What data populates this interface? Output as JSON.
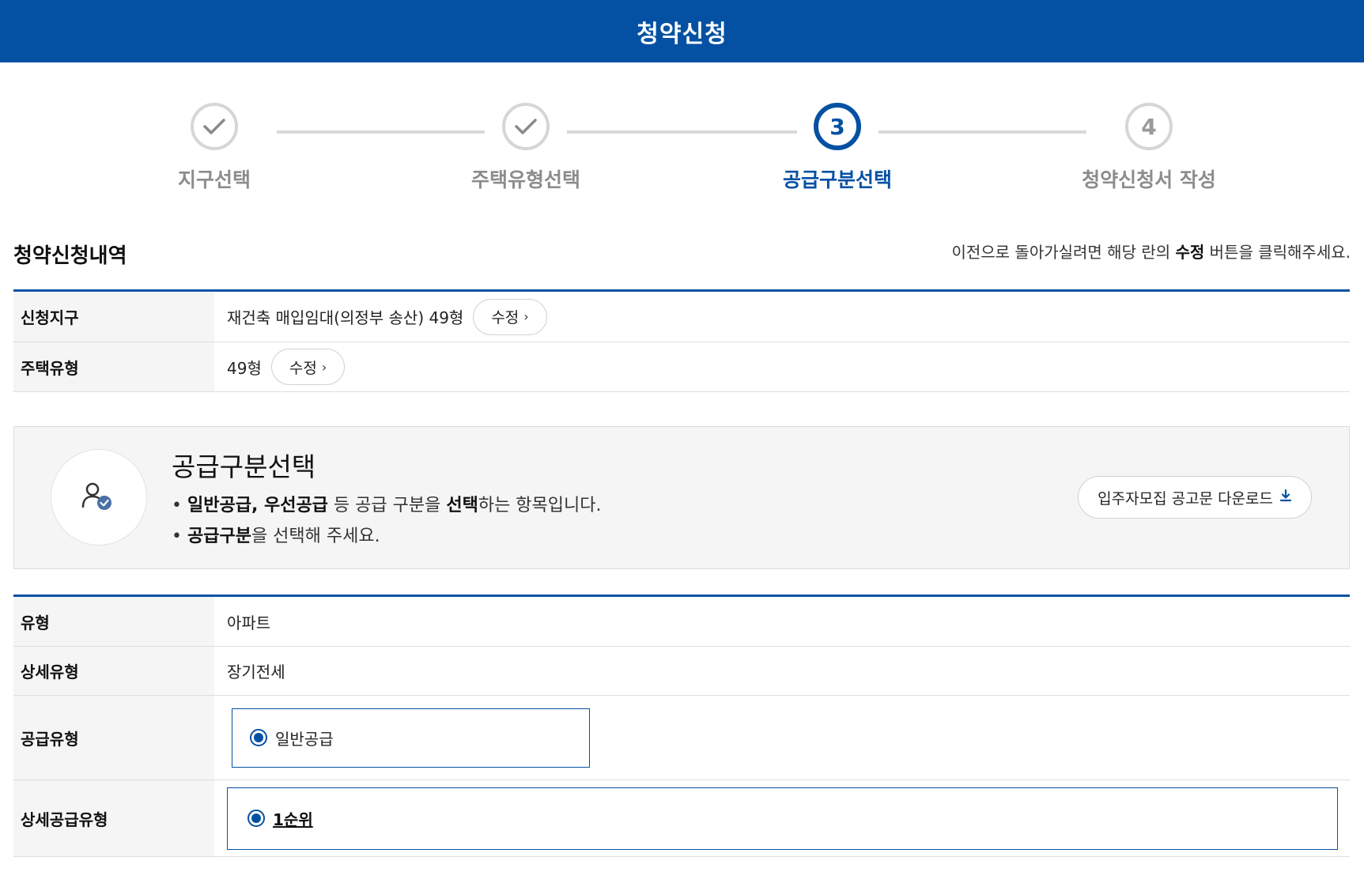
{
  "header": {
    "title": "청약신청"
  },
  "stepper": {
    "steps": [
      {
        "label": "지구선택",
        "state": "done",
        "icon": "check-icon"
      },
      {
        "label": "주택유형선택",
        "state": "done",
        "icon": "check-icon"
      },
      {
        "label": "공급구분선택",
        "state": "active",
        "number": "3"
      },
      {
        "label": "청약신청서 작성",
        "state": "pending",
        "number": "4"
      }
    ]
  },
  "summary": {
    "title": "청약신청내역",
    "hint_prefix": "이전으로 돌아가실려면 해당 란의 ",
    "hint_bold": "수정",
    "hint_suffix": " 버튼을 클릭해주세요.",
    "rows": [
      {
        "label": "신청지구",
        "value": "재건축 매입임대(의정부 송산) 49형",
        "button": "수정"
      },
      {
        "label": "주택유형",
        "value": "49형",
        "button": "수정"
      }
    ]
  },
  "info": {
    "icon": "user-check-icon",
    "title": "공급구분선택",
    "bullet1": {
      "bold": "일반공급, 우선공급",
      "mid": " 등 공급 구분을 ",
      "bold2": "선택",
      "end": "하는 항목입니다."
    },
    "bullet2": {
      "bold": "공급구분",
      "end": "을 선택해 주세요."
    },
    "download_label": "입주자모집 공고문 다운로드",
    "download_icon": "download-icon"
  },
  "detail": {
    "rows": [
      {
        "label": "유형",
        "value": "아파트"
      },
      {
        "label": "상세유형",
        "value": "장기전세"
      },
      {
        "label": "공급유형",
        "option": "일반공급",
        "selected": true
      },
      {
        "label": "상세공급유형",
        "option": "1순위",
        "selected": true
      }
    ]
  },
  "colors": {
    "primary": "#0451a3",
    "muted": "#8c8c8c",
    "panel": "#f5f5f5"
  }
}
